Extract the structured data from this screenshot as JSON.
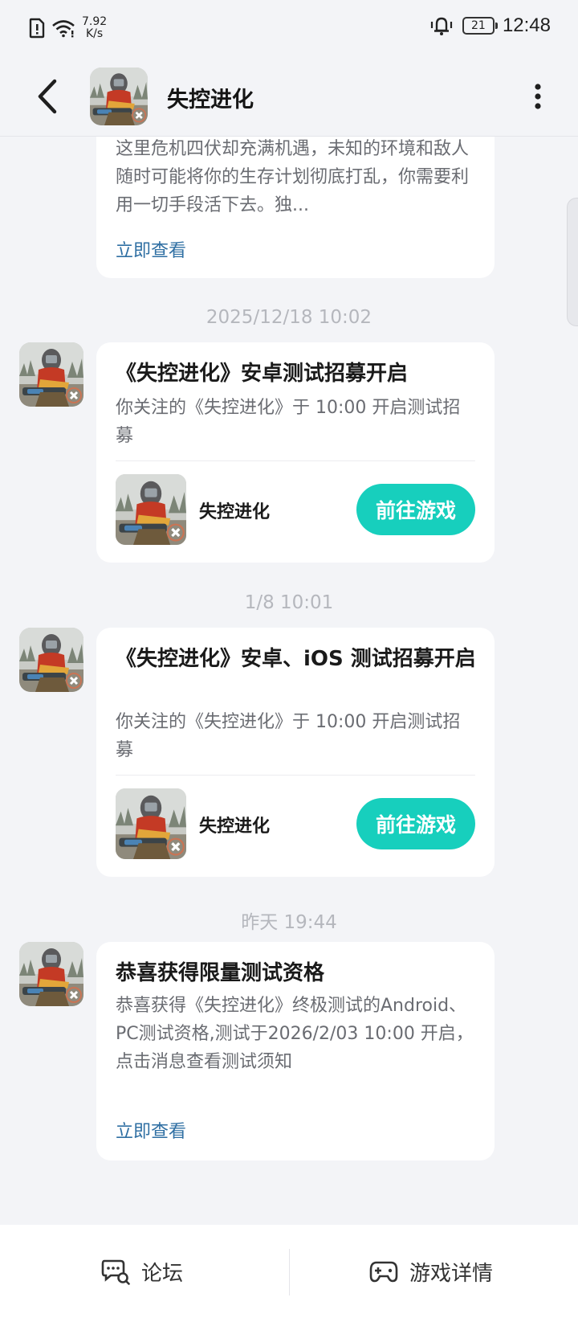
{
  "status_bar": {
    "speed_value": "7.92",
    "speed_unit": "K/s",
    "battery": "21",
    "time": "12:48"
  },
  "header": {
    "title": "失控进化"
  },
  "messages": [
    {
      "body": "这里危机四伏却充满机遇，未知的环境和敌人随时可能将你的生存计划彻底打乱，你需要利用一切手段活下去。独...",
      "link": "立即查看"
    },
    {
      "timestamp": "2025/12/18  10:02",
      "title": "《失控进化》安卓测试招募开启",
      "body": "你关注的《失控进化》于 10:00 开启测试招募",
      "game_name": "失控进化",
      "button": "前往游戏"
    },
    {
      "timestamp": "1/8  10:01",
      "title": "《失控进化》安卓、iOS 测试招募开启",
      "body": "你关注的《失控进化》于 10:00 开启测试招募",
      "game_name": "失控进化",
      "button": "前往游戏"
    },
    {
      "timestamp": "昨天  19:44",
      "title": "恭喜获得限量测试资格",
      "body": "恭喜获得《失控进化》终极测试的Android、PC测试资格,测试于2026/2/03 10:00 开启，点击消息查看测试须知",
      "link": "立即查看"
    }
  ],
  "bottom_bar": {
    "forum_label": "论坛",
    "details_label": "游戏详情"
  },
  "colors": {
    "accent": "#17cfbd",
    "link": "#2f6fa3",
    "background": "#f3f4f7"
  }
}
